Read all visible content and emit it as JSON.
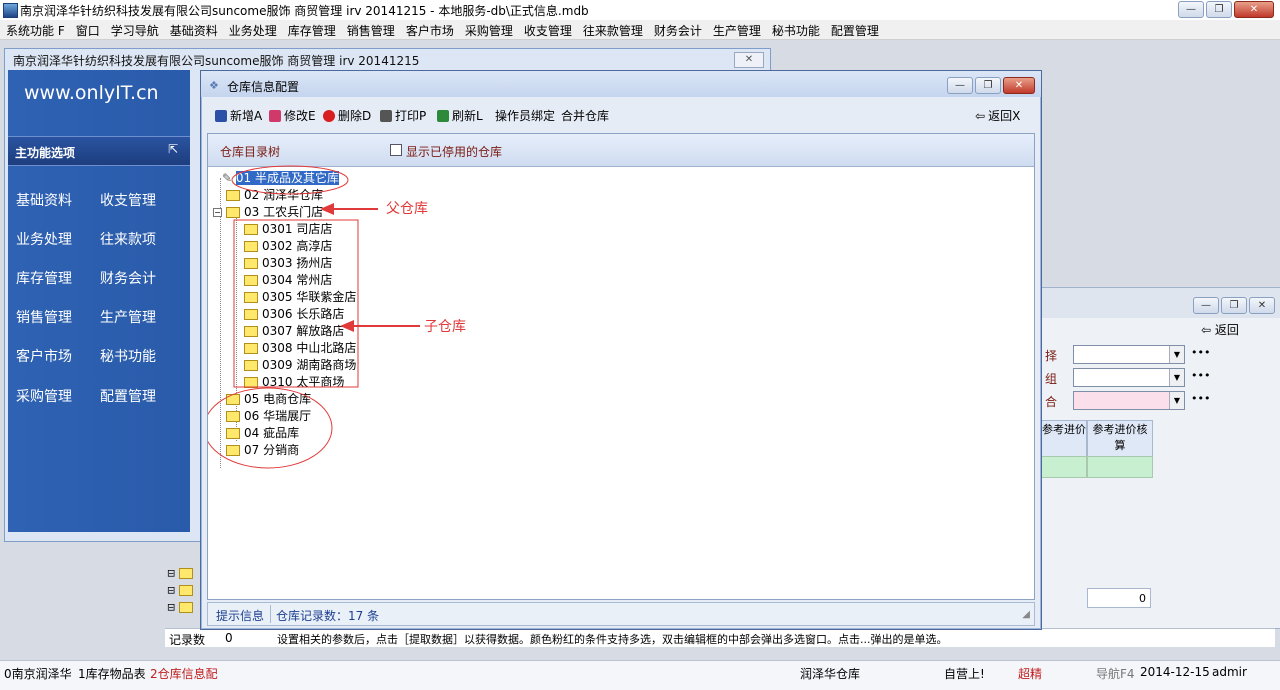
{
  "window": {
    "title": "南京润泽华针纺织科技发展有限公司suncome服饰 商贸管理 irv 20141215 - 本地服务-db\\正式信息.mdb"
  },
  "menu": [
    "系统功能 F",
    "窗口",
    "学习导航",
    "基础资料",
    "业务处理",
    "库存管理",
    "销售管理",
    "客户市场",
    "采购管理",
    "收支管理",
    "往来款管理",
    "财务会计",
    "生产管理",
    "秘书功能",
    "配置管理"
  ],
  "background_window": {
    "title": "南京润泽华针纺织科技发展有限公司suncome服饰 商贸管理 irv 20141215",
    "logo": "www.onlyIT.cn",
    "main_header": "主功能选项",
    "nav": [
      "基础资料",
      "收支管理",
      "业务处理",
      "往来款项",
      "库存管理",
      "财务会计",
      "销售管理",
      "生产管理",
      "客户市场",
      "秘书功能",
      "采购管理",
      "配置管理"
    ]
  },
  "right_window": {
    "return_label": "返回",
    "field_labels": [
      "择",
      "组",
      "合"
    ],
    "grid_headers": [
      "参考进价",
      "参考进价核算"
    ],
    "total_value": "0"
  },
  "dialog": {
    "title": "仓库信息配置",
    "toolbar": {
      "add": "新增A",
      "edit": "修改E",
      "delete": "删除D",
      "print": "打印P",
      "refresh": "刷新L",
      "bind": "操作员绑定",
      "merge": "合并仓库",
      "back": "返回X"
    },
    "tree_header": "仓库目录树",
    "show_disabled_label": "显示已停用的仓库",
    "tree": {
      "n01": "01 半成品及其它库",
      "n02": "02 润泽华仓库",
      "n03": "03 工农兵门店",
      "c0301": "0301 司店店",
      "c0302": "0302 高淳店",
      "c0303": "0303 扬州店",
      "c0304": "0304 常州店",
      "c0305": "0305 华联紫金店",
      "c0306": "0306 长乐路店",
      "c0307": "0307 解放路店",
      "c0308": "0308 中山北路店",
      "c0309": "0309 湖南路商场",
      "c0310": "0310 太平商场",
      "n05": "05 电商仓库",
      "n06": "06 华瑞展厅",
      "n04": "04 疵品库",
      "n07": "07 分销商"
    },
    "status": {
      "hint": "提示信息",
      "count": "仓库记录数：17 条"
    },
    "annotations": {
      "parent": "父仓库",
      "child": "子仓库"
    }
  },
  "statusline": {
    "label": "记录数",
    "value": "0",
    "message": "设置相关的参数后，点击［提取数据］以获得数据。颜色粉红的条件支持多选，双击编辑框的中部会弹出多选窗口。点击...弹出的是单选。"
  },
  "taskbar": {
    "items": [
      "0南京润泽华",
      "1库存物品表",
      "2仓库信息配"
    ],
    "warehouse": "润泽华仓库",
    "store": "自营上!",
    "user_label": "超精",
    "nav_label": "导航F4",
    "date": "2014-12-15",
    "user": "admir"
  },
  "colors": {
    "sidebar": "#2f62b3",
    "annotation": "#e03a3a",
    "selected": "#3169c6",
    "folder": "#ffe86b"
  }
}
